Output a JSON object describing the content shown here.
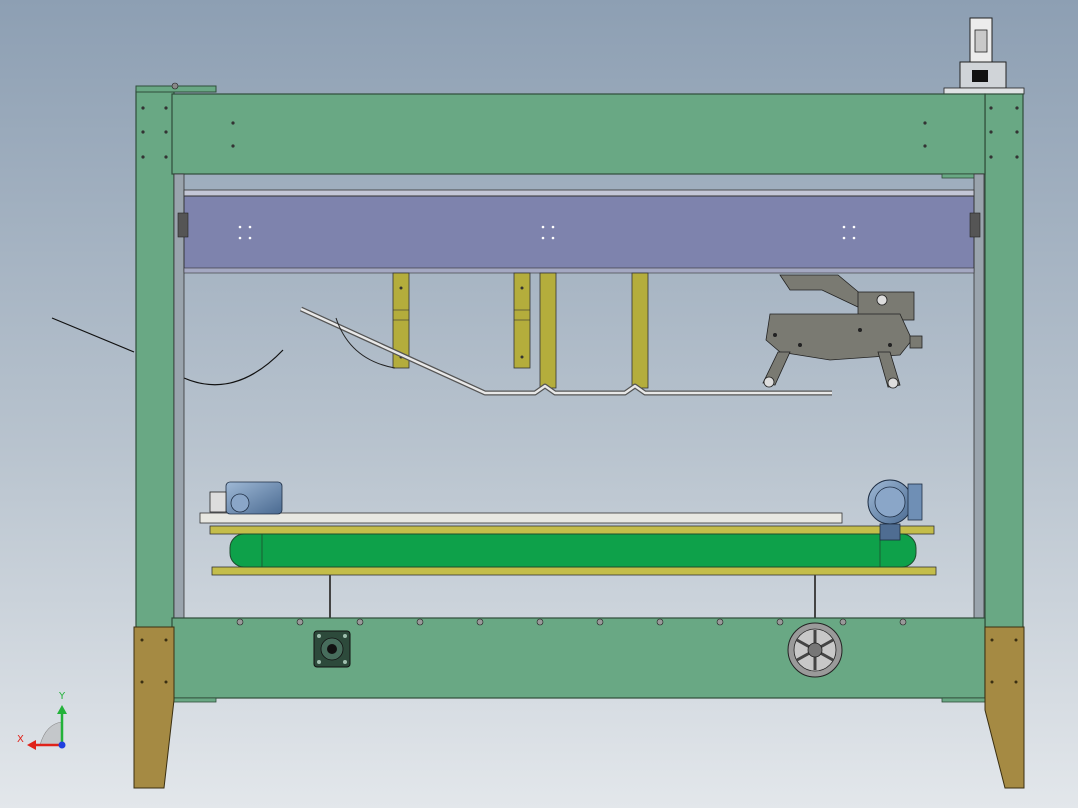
{
  "viewport": {
    "background": {
      "top": "#8d9fb3",
      "mid": "#b8c3ce",
      "bottom": "#e3e7eb"
    }
  },
  "colors": {
    "frame_green": "#69a884",
    "frame_edge": "#2f4d3a",
    "beam_purple": "#7e83ad",
    "bracket_yellow": "#b4ad3c",
    "belt_green": "#0ea14a",
    "foot_gold": "#a58a43",
    "motor_blue": "#6f8fb5",
    "gripper_gray": "#7a7a72"
  },
  "triad": {
    "x_label": "X",
    "y_label": "Y",
    "x_color": "#e0231a",
    "y_color": "#23b23a",
    "z_color": "#2040e0"
  },
  "model": {
    "parts": [
      "frame-upright-left",
      "frame-upright-right",
      "frame-top-rail",
      "frame-bottom-rail",
      "support-beam",
      "hanging-bracket",
      "guide-rod",
      "gripper-mechanism",
      "conveyor-table",
      "conveyor-belt",
      "drive-motor-left",
      "drive-motor-right",
      "flange-bearing",
      "handwheel",
      "leveling-foot-left",
      "leveling-foot-right",
      "top-sensor-assembly"
    ]
  }
}
